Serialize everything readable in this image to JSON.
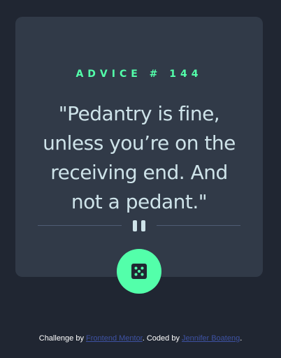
{
  "card": {
    "advice_label": "ADVICE # 144",
    "quote": "\"Pedantry is fine, unless you’re on the receiving end. And not a pedant.\""
  },
  "button": {
    "icon": "dice-icon"
  },
  "colors": {
    "background": "#202632",
    "card": "#313a48",
    "accent": "#53ffaa",
    "text": "#cee3e9",
    "link": "#3e52a3"
  },
  "footer": {
    "prefix": "Challenge by ",
    "link1": "Frontend Mentor",
    "middle": ". Coded by ",
    "link2": "Jennifer Boateng",
    "suffix": "."
  }
}
